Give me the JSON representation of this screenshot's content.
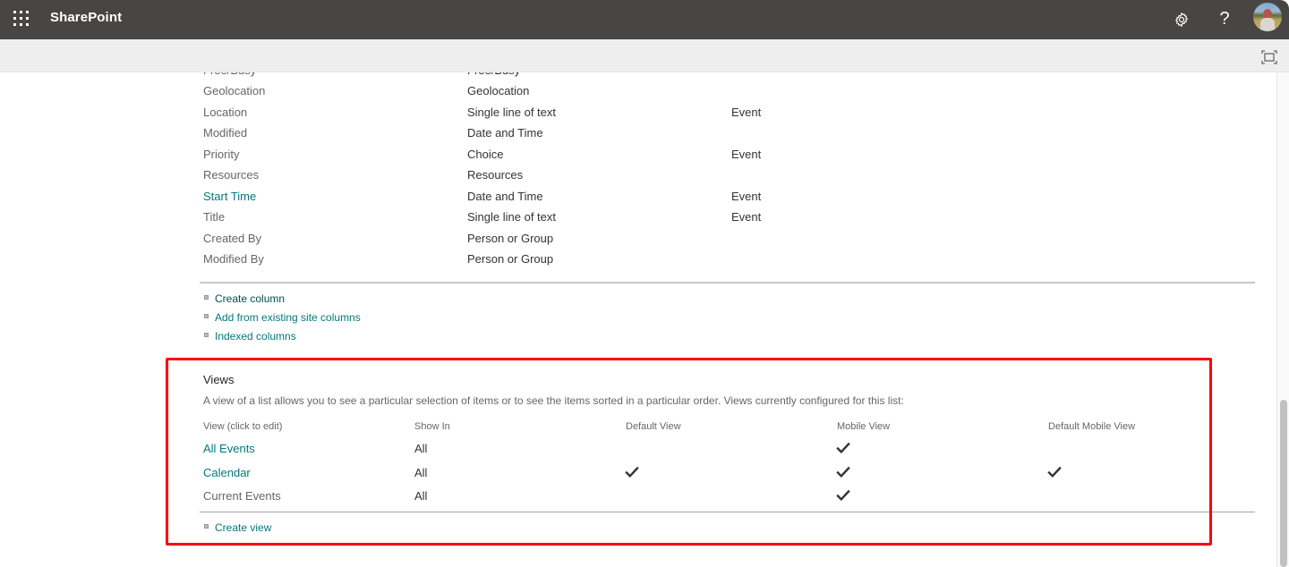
{
  "suite_bar": {
    "app_launcher_icon": "waffle-grid-icon",
    "app_title": "SharePoint",
    "settings_icon": "gear-icon",
    "help_label": "?",
    "help_icon": "question-mark-icon",
    "avatar_icon": "user-avatar-photo"
  },
  "command_bar": {
    "focus_mode_icon": "focus-mode-icon"
  },
  "columns_section": {
    "partial_top_row": {
      "name": "Free/Busy",
      "type": "Free/Busy",
      "used_in": ""
    },
    "rows": [
      {
        "name": "Geolocation",
        "type": "Geolocation",
        "used_in": "",
        "is_link": false
      },
      {
        "name": "Location",
        "type": "Single line of text",
        "used_in": "Event",
        "is_link": false
      },
      {
        "name": "Modified",
        "type": "Date and Time",
        "used_in": "",
        "is_link": false
      },
      {
        "name": "Priority",
        "type": "Choice",
        "used_in": "Event",
        "is_link": false
      },
      {
        "name": "Resources",
        "type": "Resources",
        "used_in": "",
        "is_link": false
      },
      {
        "name": "Start Time",
        "type": "Date and Time",
        "used_in": "Event",
        "is_link": true
      },
      {
        "name": "Title",
        "type": "Single line of text",
        "used_in": "Event",
        "is_link": false
      },
      {
        "name": "Created By",
        "type": "Person or Group",
        "used_in": "",
        "is_link": false
      },
      {
        "name": "Modified By",
        "type": "Person or Group",
        "used_in": "",
        "is_link": false
      }
    ],
    "links": [
      {
        "label": "Create column"
      },
      {
        "label": "Add from existing site columns"
      },
      {
        "label": "Indexed columns"
      }
    ]
  },
  "views_section": {
    "title": "Views",
    "description": "A view of a list allows you to see a particular selection of items or to see the items sorted in a particular order. Views currently configured for this list:",
    "headers": {
      "view": "View (click to edit)",
      "show_in": "Show In",
      "default_view": "Default View",
      "mobile_view": "Mobile View",
      "default_mobile_view": "Default Mobile View"
    },
    "rows": [
      {
        "name": "All Events",
        "show_in": "All",
        "default_view": false,
        "mobile_view": true,
        "default_mobile_view": false,
        "is_link": true
      },
      {
        "name": "Calendar",
        "show_in": "All",
        "default_view": true,
        "mobile_view": true,
        "default_mobile_view": true,
        "is_link": true
      },
      {
        "name": "Current Events",
        "show_in": "All",
        "default_view": false,
        "mobile_view": true,
        "default_mobile_view": false,
        "is_link": false
      }
    ],
    "create_view_label": "Create view",
    "check_icon": "checkmark-icon"
  },
  "colors": {
    "suite_bar_bg": "#484644",
    "command_bar_bg": "#eeeeee",
    "link": "#03787c",
    "highlight_border": "#ff0000"
  }
}
